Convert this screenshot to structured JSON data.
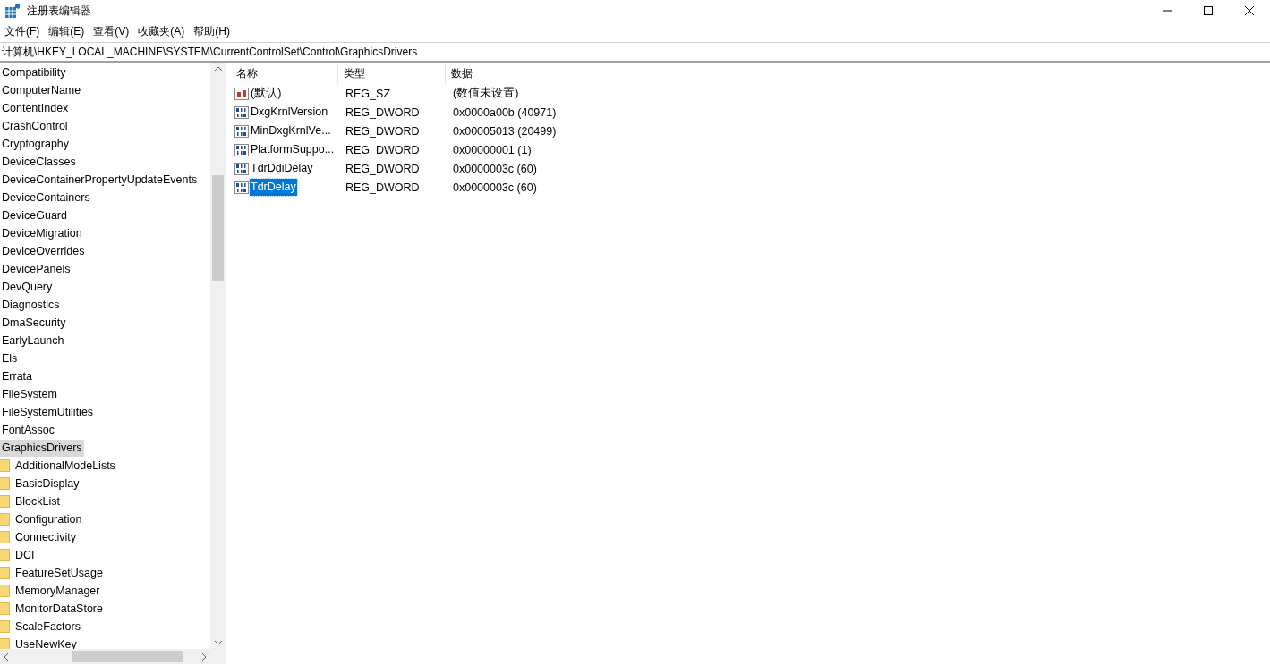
{
  "window": {
    "title": "注册表编辑器"
  },
  "menu": [
    {
      "label": "文件(F)"
    },
    {
      "label": "编辑(E)"
    },
    {
      "label": "查看(V)"
    },
    {
      "label": "收藏夹(A)"
    },
    {
      "label": "帮助(H)"
    }
  ],
  "address": "计算机\\HKEY_LOCAL_MACHINE\\SYSTEM\\CurrentControlSet\\Control\\GraphicsDrivers",
  "tree": [
    {
      "label": "Compatibility",
      "selected": false
    },
    {
      "label": "ComputerName",
      "selected": false
    },
    {
      "label": "ContentIndex",
      "selected": false
    },
    {
      "label": "CrashControl",
      "selected": false
    },
    {
      "label": "Cryptography",
      "selected": false
    },
    {
      "label": "DeviceClasses",
      "selected": false
    },
    {
      "label": "DeviceContainerPropertyUpdateEvents",
      "selected": false
    },
    {
      "label": "DeviceContainers",
      "selected": false
    },
    {
      "label": "DeviceGuard",
      "selected": false
    },
    {
      "label": "DeviceMigration",
      "selected": false
    },
    {
      "label": "DeviceOverrides",
      "selected": false
    },
    {
      "label": "DevicePanels",
      "selected": false
    },
    {
      "label": "DevQuery",
      "selected": false
    },
    {
      "label": "Diagnostics",
      "selected": false
    },
    {
      "label": "DmaSecurity",
      "selected": false
    },
    {
      "label": "EarlyLaunch",
      "selected": false
    },
    {
      "label": "Els",
      "selected": false
    },
    {
      "label": "Errata",
      "selected": false
    },
    {
      "label": "FileSystem",
      "selected": false
    },
    {
      "label": "FileSystemUtilities",
      "selected": false
    },
    {
      "label": "FontAssoc",
      "selected": false
    },
    {
      "label": "GraphicsDrivers",
      "selected": true,
      "children": [
        {
          "label": "AdditionalModeLists",
          "selected": false
        },
        {
          "label": "BasicDisplay",
          "selected": false
        },
        {
          "label": "BlockList",
          "selected": false
        },
        {
          "label": "Configuration",
          "selected": false
        },
        {
          "label": "Connectivity",
          "selected": false
        },
        {
          "label": "DCI",
          "selected": false
        },
        {
          "label": "FeatureSetUsage",
          "selected": false
        },
        {
          "label": "MemoryManager",
          "selected": false
        },
        {
          "label": "MonitorDataStore",
          "selected": false
        },
        {
          "label": "ScaleFactors",
          "selected": false
        },
        {
          "label": "UseNewKey",
          "selected": false
        }
      ]
    }
  ],
  "columns": [
    "名称",
    "类型",
    "数据"
  ],
  "values": [
    {
      "kind": "string",
      "name": "(默认)",
      "type": "REG_SZ",
      "data": "(数值未设置)",
      "selected": false
    },
    {
      "kind": "binary",
      "name": "DxgKrnlVersion",
      "type": "REG_DWORD",
      "data": "0x0000a00b (40971)",
      "selected": false
    },
    {
      "kind": "binary",
      "name": "MinDxgKrnlVe...",
      "type": "REG_DWORD",
      "data": "0x00005013 (20499)",
      "selected": false
    },
    {
      "kind": "binary",
      "name": "PlatformSuppo...",
      "type": "REG_DWORD",
      "data": "0x00000001 (1)",
      "selected": false
    },
    {
      "kind": "binary",
      "name": "TdrDdiDelay",
      "type": "REG_DWORD",
      "data": "0x0000003c (60)",
      "selected": false
    },
    {
      "kind": "binary",
      "name": "TdrDelay",
      "type": "REG_DWORD",
      "data": "0x0000003c (60)",
      "selected": true
    }
  ]
}
